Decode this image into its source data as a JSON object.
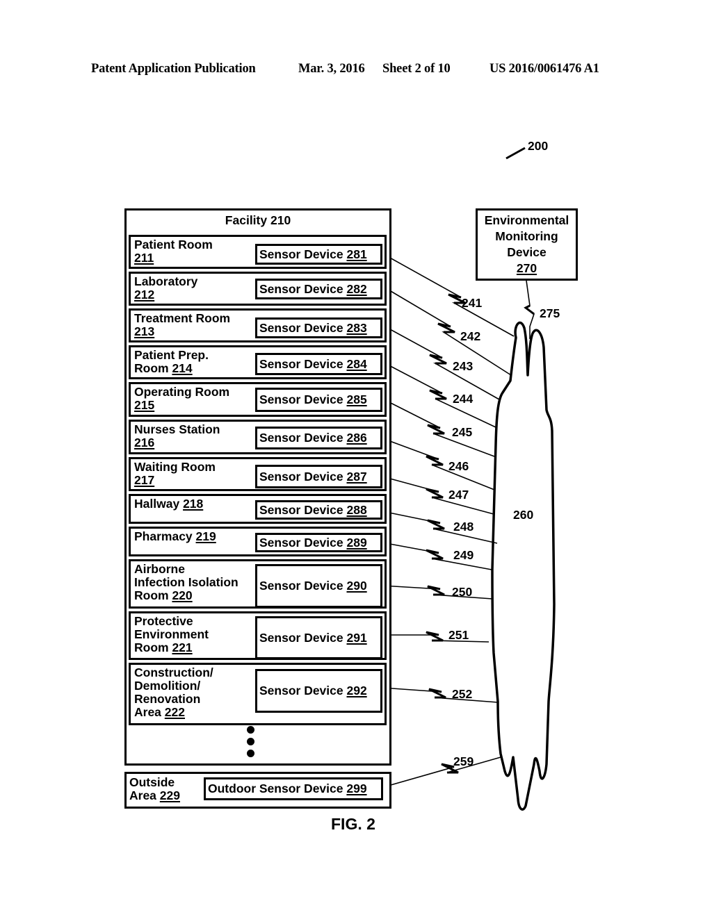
{
  "header": {
    "publication": "Patent Application Publication",
    "date": "Mar. 3, 2016",
    "sheet": "Sheet 2 of 10",
    "number": "US 2016/0061476 A1"
  },
  "figure": {
    "ref": "200",
    "caption": "FIG. 2",
    "facility": {
      "name": "Facility",
      "ref": "210"
    },
    "rooms": [
      {
        "lines": [
          "Patient Room"
        ],
        "ref": "211",
        "ref_inline": false,
        "sensor": "Sensor Device",
        "sensor_ref": "281",
        "link": "241"
      },
      {
        "lines": [
          "Laboratory"
        ],
        "ref": "212",
        "ref_inline": false,
        "sensor": "Sensor Device",
        "sensor_ref": "282",
        "link": "242"
      },
      {
        "lines": [
          "Treatment Room"
        ],
        "ref": "213",
        "ref_inline": false,
        "sensor": "Sensor Device",
        "sensor_ref": "283",
        "link": "243"
      },
      {
        "lines": [
          "Patient Prep.",
          "Room"
        ],
        "ref": "214",
        "ref_inline": true,
        "sensor": "Sensor Device",
        "sensor_ref": "284",
        "link": "244"
      },
      {
        "lines": [
          "Operating Room"
        ],
        "ref": "215",
        "ref_inline": false,
        "sensor": "Sensor Device",
        "sensor_ref": "285",
        "link": "245"
      },
      {
        "lines": [
          "Nurses Station"
        ],
        "ref": "216",
        "ref_inline": false,
        "sensor": "Sensor Device",
        "sensor_ref": "286",
        "link": "246"
      },
      {
        "lines": [
          "Waiting Room"
        ],
        "ref": "217",
        "ref_inline": false,
        "sensor": "Sensor Device",
        "sensor_ref": "287",
        "link": "247"
      },
      {
        "lines": [
          "Hallway"
        ],
        "ref": "218",
        "ref_inline": true,
        "sensor": "Sensor Device",
        "sensor_ref": "288",
        "link": "248"
      },
      {
        "lines": [
          "Pharmacy"
        ],
        "ref": "219",
        "ref_inline": true,
        "sensor": "Sensor Device",
        "sensor_ref": "289",
        "link": "249"
      },
      {
        "lines": [
          "Airborne",
          "Infection Isolation",
          "Room"
        ],
        "ref": "220",
        "ref_inline": true,
        "sensor": "Sensor Device",
        "sensor_ref": "290",
        "link": "250"
      },
      {
        "lines": [
          "Protective",
          "Environment",
          "Room"
        ],
        "ref": "221",
        "ref_inline": true,
        "sensor": "Sensor Device",
        "sensor_ref": "291",
        "link": "251"
      },
      {
        "lines": [
          "Construction/",
          "Demolition/",
          "Renovation",
          "Area"
        ],
        "ref": "222",
        "ref_inline": true,
        "sensor": "Sensor Device",
        "sensor_ref": "292",
        "link": "252"
      }
    ],
    "outside": {
      "lines": [
        "Outside",
        "Area"
      ],
      "ref": "229",
      "sensor": "Outdoor Sensor Device",
      "sensor_ref": "299",
      "link": "259"
    },
    "monitor": {
      "lines": [
        "Environmental",
        "Monitoring",
        "Device"
      ],
      "ref": "270",
      "link": "275"
    },
    "network": {
      "ref": "260"
    }
  }
}
